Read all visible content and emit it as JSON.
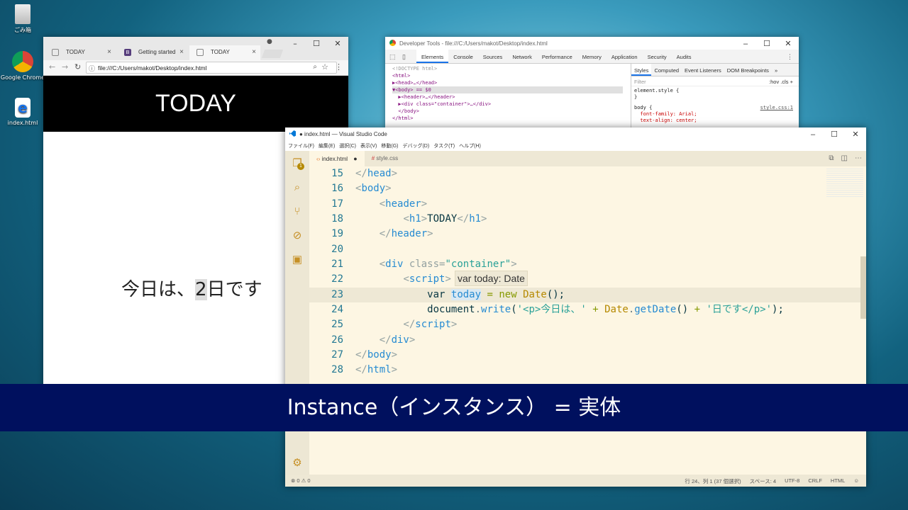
{
  "desktop": {
    "icons": [
      {
        "label": "ごみ箱"
      },
      {
        "label": "Google Chrome"
      },
      {
        "label": "index.html"
      }
    ]
  },
  "chrome": {
    "tabs": [
      {
        "label": "TODAY"
      },
      {
        "label": "Getting started"
      },
      {
        "label": "TODAY"
      }
    ],
    "url": "file:///C:/Users/makot/Desktop/index.html",
    "page_heading": "TODAY",
    "page_text_before": "今日は、",
    "page_text_highlight": "2",
    "page_text_after": "日です"
  },
  "devtools": {
    "title": "Developer Tools - file:///C:/Users/makot/Desktop/index.html",
    "tabs": [
      "Elements",
      "Console",
      "Sources",
      "Network",
      "Performance",
      "Memory",
      "Application",
      "Security",
      "Audits"
    ],
    "dom_lines": [
      "<!DOCTYPE html>",
      "<html>",
      "▶<head>…</head>",
      "▼<body> == $0",
      "  ▶<header>…</header>",
      "  ▶<div class=\"container\">…</div>",
      "  </body>",
      "</html>"
    ],
    "style_tabs": [
      "Styles",
      "Computed",
      "Event Listeners",
      "DOM Breakpoints"
    ],
    "filter_placeholder": "Filter",
    "filter_tools": ":hov  .cls  +",
    "rules": [
      "element.style {",
      "}",
      "body {",
      "  font-family: Arial;",
      "  text-align: center;"
    ],
    "rule_source": "style.css:1"
  },
  "vscode": {
    "title": "● index.html — Visual Studio Code",
    "menu": [
      "ファイル(F)",
      "編集(E)",
      "選択(C)",
      "表示(V)",
      "移動(G)",
      "デバッグ(D)",
      "タスク(T)",
      "ヘルプ(H)"
    ],
    "explorer_badge": "1",
    "tabs": [
      {
        "label": "index.html",
        "modified": "●"
      },
      {
        "label": "style.css"
      }
    ],
    "line_numbers": [
      "15",
      "16",
      "17",
      "18",
      "19",
      "20",
      "21",
      "22",
      "23",
      "24",
      "25",
      "26",
      "27",
      "28"
    ],
    "hover_text": "var today: Date",
    "status": {
      "problems": "⊗ 0  ⚠ 0",
      "position": "行 24、列 1 (37 個選択)",
      "spaces": "スペース: 4",
      "encoding": "UTF-8",
      "eol": "CRLF",
      "language": "HTML"
    }
  },
  "caption": "Instance（インスタンス） = 実体"
}
